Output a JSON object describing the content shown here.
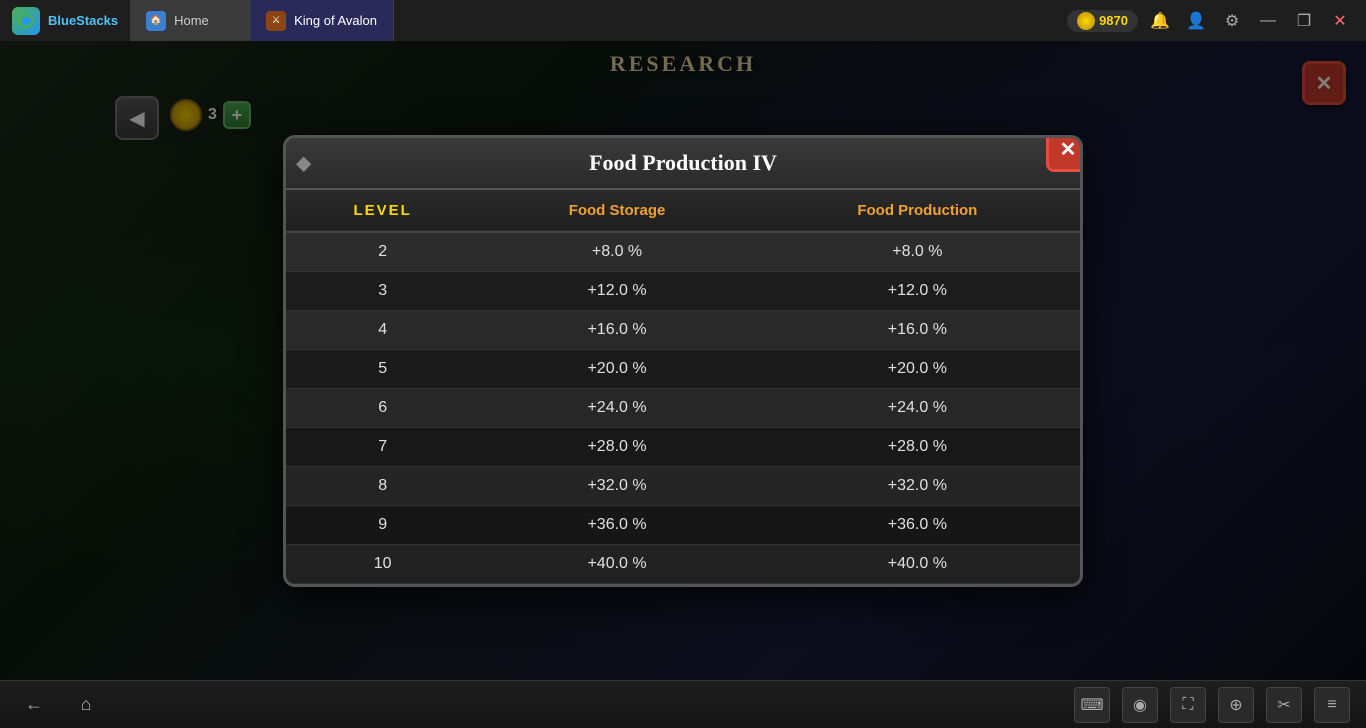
{
  "titlebar": {
    "app_name": "BlueStacks",
    "home_tab": "Home",
    "game_tab": "King of Avalon",
    "coins": "9870",
    "window_controls": {
      "minimize": "—",
      "restore": "❐",
      "close": "✕"
    }
  },
  "game": {
    "research_header": "RESEARCH",
    "back_arrow": "◀",
    "coin_count": "3",
    "add_label": "+",
    "close_label": "✕"
  },
  "modal": {
    "title": "Food Production IV",
    "close_label": "✕",
    "table": {
      "headers": {
        "level": "LEVEL",
        "food_storage": "Food Storage",
        "food_production": "Food Production"
      },
      "rows": [
        {
          "level": "2",
          "food_storage": "+8.0 %",
          "food_production": "+8.0 %",
          "dimmed": true
        },
        {
          "level": "3",
          "food_storage": "+12.0 %",
          "food_production": "+12.0 %",
          "dimmed": false
        },
        {
          "level": "4",
          "food_storage": "+16.0 %",
          "food_production": "+16.0 %",
          "dimmed": false
        },
        {
          "level": "5",
          "food_storage": "+20.0 %",
          "food_production": "+20.0 %",
          "dimmed": false
        },
        {
          "level": "6",
          "food_storage": "+24.0 %",
          "food_production": "+24.0 %",
          "dimmed": false
        },
        {
          "level": "7",
          "food_storage": "+28.0 %",
          "food_production": "+28.0 %",
          "dimmed": false
        },
        {
          "level": "8",
          "food_storage": "+32.0 %",
          "food_production": "+32.0 %",
          "dimmed": false
        },
        {
          "level": "9",
          "food_storage": "+36.0 %",
          "food_production": "+36.0 %",
          "dimmed": false
        },
        {
          "level": "10",
          "food_storage": "+40.0 %",
          "food_production": "+40.0 %",
          "dimmed": false
        }
      ]
    }
  },
  "taskbar": {
    "back_icon": "←",
    "home_icon": "⌂",
    "keyboard_icon": "⌨",
    "eye_icon": "◉",
    "expand_icon": "⛶",
    "location_icon": "⊕",
    "scissors_icon": "✂",
    "menu_icon": "≡"
  }
}
